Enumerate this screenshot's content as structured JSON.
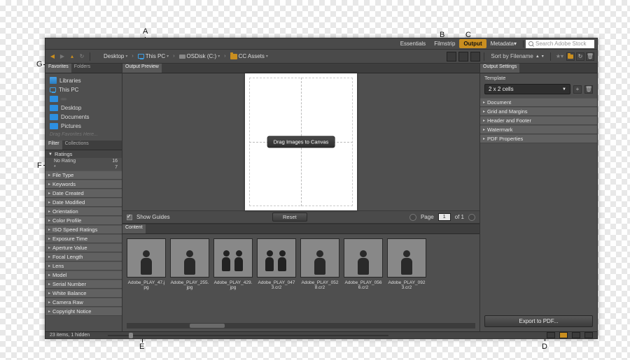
{
  "workspace": {
    "items": [
      "Essentials",
      "Filmstrip",
      "Output",
      "Metadata"
    ],
    "active": "Output",
    "search_placeholder": "Search Adobe Stock"
  },
  "breadcrumb": {
    "items": [
      "Desktop",
      "This PC",
      "OSDisk (C:)",
      "CC Assets"
    ]
  },
  "sort_label": "Sort by Filename",
  "left": {
    "tabs_a": [
      "Favorites",
      "Folders"
    ],
    "favorites": [
      "Libraries",
      "This PC",
      "—",
      "Desktop",
      "Documents",
      "Pictures"
    ],
    "hint": "Drag Favorites Here...",
    "tabs_b": [
      "Filter",
      "Collections"
    ],
    "ratings_header": "Ratings",
    "ratings": [
      {
        "label": "No Rating",
        "count": "16"
      },
      {
        "label": "*",
        "count": "7"
      }
    ],
    "accordions": [
      "File Type",
      "Keywords",
      "Date Created",
      "Date Modified",
      "Orientation",
      "Color Profile",
      "ISO Speed Ratings",
      "Exposure Time",
      "Aperture Value",
      "Focal Length",
      "Lens",
      "Model",
      "Serial Number",
      "White Balance",
      "Camera Raw",
      "Copyright Notice"
    ]
  },
  "center": {
    "preview_tab": "Output Preview",
    "drag_label": "Drag Images to Canvas",
    "show_guides": "Show Guides",
    "reset": "Reset",
    "page_label": "Page",
    "page_value": "1",
    "page_of": "of 1",
    "content_tab": "Content",
    "thumbs": [
      "Adobe_PLAY_47.jpg",
      "Adobe_PLAY_255.jpg",
      "Adobe_PLAY_429.jpg",
      "Adobe_PLAY_0473.cr2",
      "Adobe_PLAY_0528.cr2",
      "Adobe_PLAY_0566.cr2",
      "Adobe_PLAY_0923.cr2"
    ]
  },
  "right": {
    "tab": "Output Settings",
    "template_label": "Template",
    "template_value": "2 x 2 cells",
    "accordions": [
      "Document",
      "Grid and Margins",
      "Header and Footer",
      "Watermark",
      "PDF Properties"
    ],
    "export": "Export to PDF..."
  },
  "status": "23 items, 1 hidden",
  "callouts": {
    "A": "A",
    "B": "B",
    "C": "C",
    "D": "D",
    "E": "E",
    "F": "F",
    "G": "G"
  }
}
